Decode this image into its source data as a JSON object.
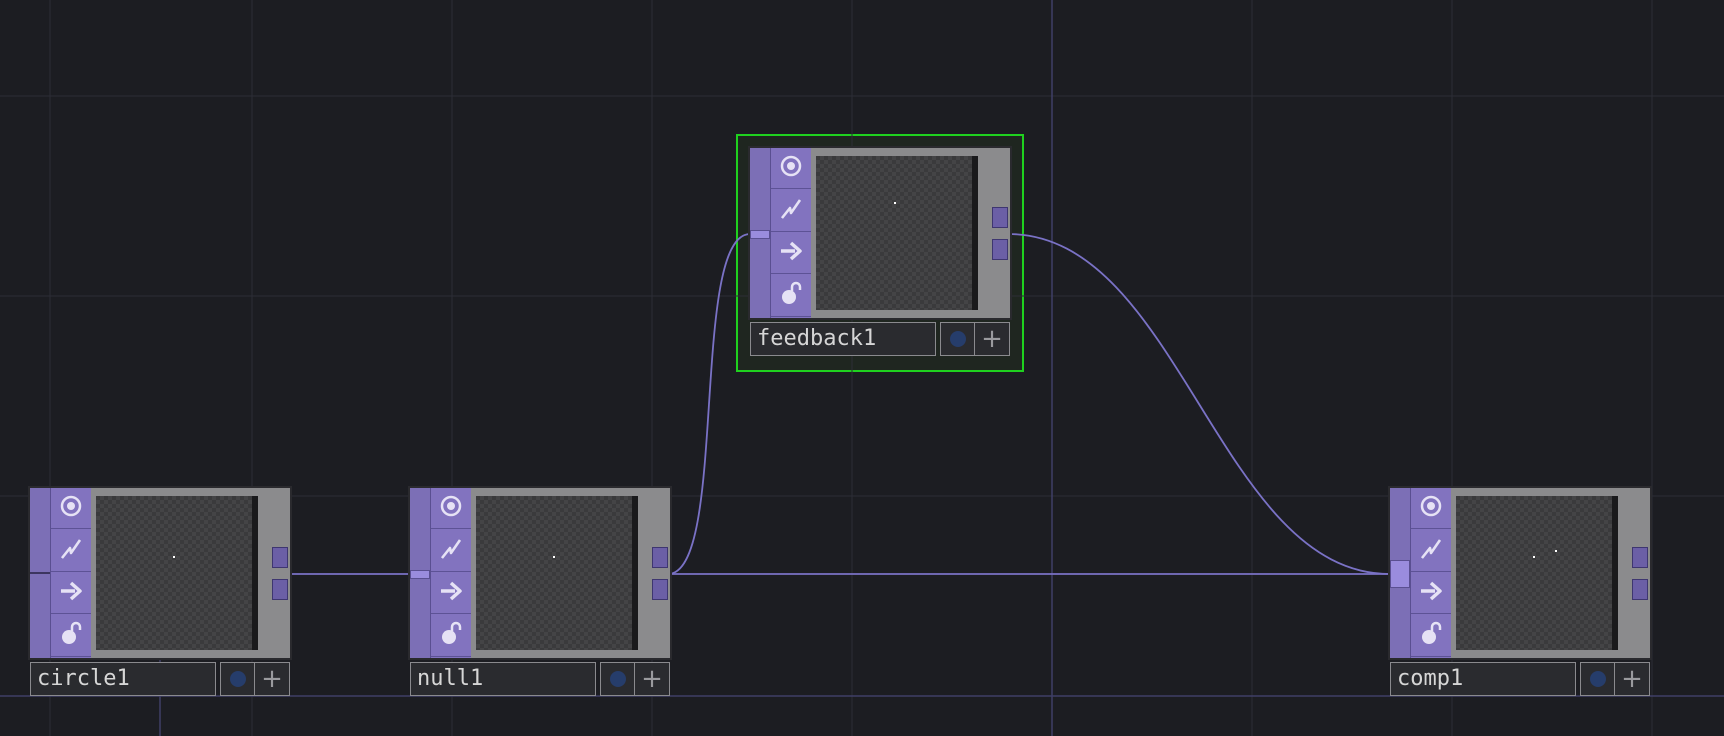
{
  "network": {
    "nodes": [
      {
        "id": "circle1",
        "name": "circle1",
        "selected": false
      },
      {
        "id": "null1",
        "name": "null1",
        "selected": false
      },
      {
        "id": "feedback1",
        "name": "feedback1",
        "selected": true
      },
      {
        "id": "comp1",
        "name": "comp1",
        "selected": false
      }
    ],
    "connections": [
      {
        "from": "circle1",
        "to": "null1"
      },
      {
        "from": "null1",
        "to": "feedback1"
      },
      {
        "from": "null1",
        "to": "comp1"
      },
      {
        "from": "feedback1",
        "to": "comp1"
      }
    ],
    "flags": [
      "viewer-active-icon",
      "bypass-icon",
      "display-icon",
      "lock-icon"
    ],
    "colors": {
      "background": "#1c1d22",
      "grid": "#2c2d36",
      "wire": "#7a72c6",
      "selected_outline": "#1fd11f",
      "operator_strip": "#8273bf"
    }
  }
}
